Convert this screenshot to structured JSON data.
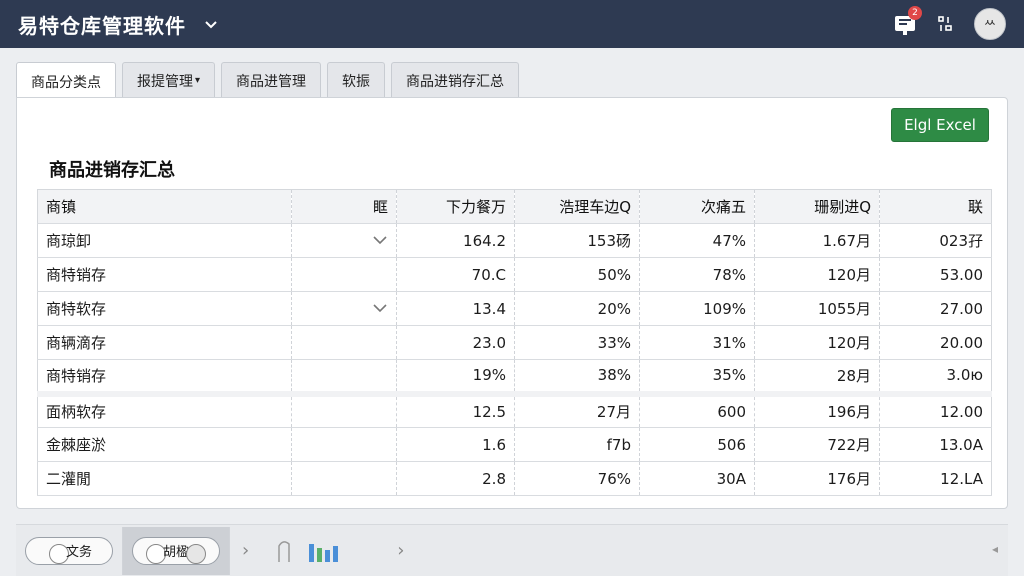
{
  "app": {
    "title": "易特仓库管理软件",
    "notif_count": "2",
    "avatar_text": "ᄊ"
  },
  "tabs": [
    {
      "label": "商品分类点",
      "active": true
    },
    {
      "label": "报提管理",
      "has_caret": true
    },
    {
      "label": "商品进管理"
    },
    {
      "label": "软振"
    },
    {
      "label": "商品进销存汇总"
    }
  ],
  "toolbar": {
    "export_label": "Elgl Excel"
  },
  "report": {
    "title": "商品进销存汇总",
    "columns": [
      "商镇",
      "眶",
      "下力餐万",
      "浩理车边Q",
      "次痛五",
      "珊剔进Q",
      "联"
    ],
    "rows": [
      [
        "商琼卸",
        "",
        "164.2",
        "153砀",
        "47%",
        "1.67月",
        "023孖"
      ],
      [
        "商特销存",
        "",
        "70.C",
        "50%",
        "78%",
        "120月",
        "53.00"
      ],
      [
        "商特软存",
        "",
        "13.4",
        "20%",
        "109%",
        "1055月",
        "27.00"
      ],
      [
        "商辆滴存",
        "",
        "23.0",
        "33%",
        "31%",
        "120月",
        "20.00"
      ],
      [
        "商特销存",
        "",
        "19%",
        "38%",
        "35%",
        "28月",
        "3.0ю"
      ],
      [
        "面柄软存",
        "",
        "12.5",
        "27月",
        "600",
        "196月",
        "12.00"
      ],
      [
        "金棘座淤",
        "",
        "1.6",
        "f7b",
        "506",
        "722月",
        "13.0A"
      ],
      [
        "二灌閒",
        "",
        "2.8",
        "76%",
        "30A",
        "176月",
        "12.LA"
      ]
    ],
    "row_chevrons": [
      true,
      false,
      true,
      false,
      false,
      false,
      false,
      false
    ]
  },
  "bottombar": {
    "toggle1_label": "文务",
    "toggle2_label": "胡楹"
  },
  "colors": {
    "titlebar": "#2e3a52",
    "export_button": "#2e8b45",
    "badge": "#e04848"
  },
  "icons": [
    "chevron-down-icon",
    "notification-icon",
    "settings-icon",
    "chart-icon",
    "chevron-right-icon"
  ]
}
